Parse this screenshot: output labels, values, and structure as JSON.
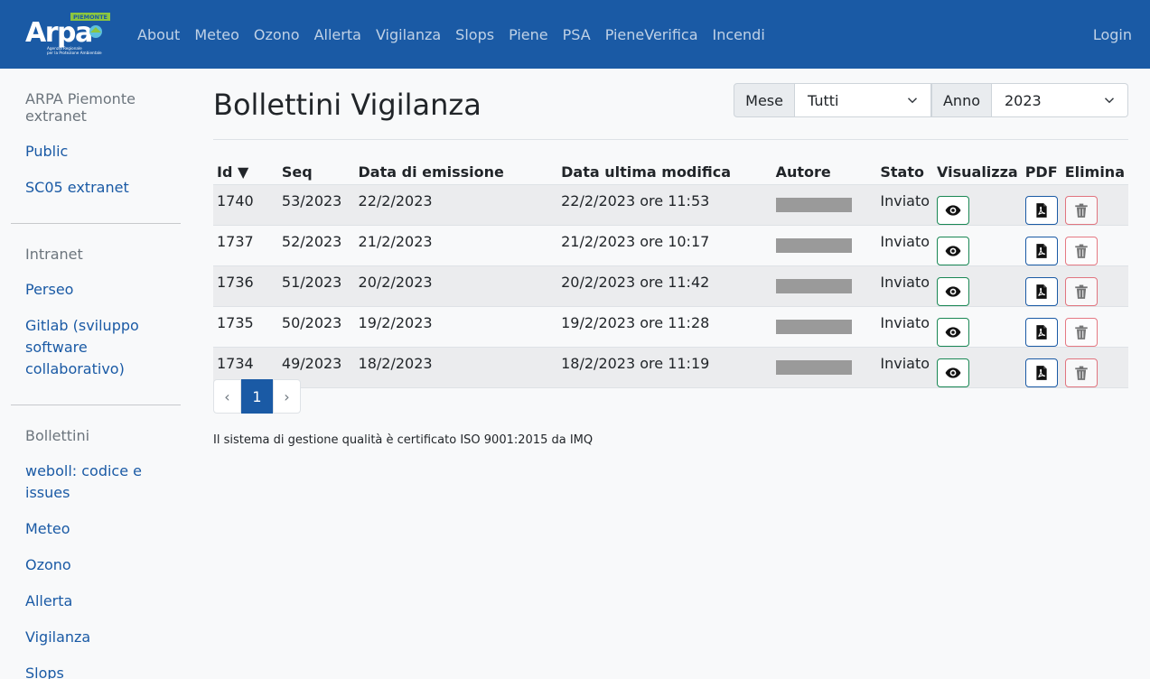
{
  "navbar": {
    "logo_text": "Arpa",
    "logo_region": "PIEMONTE",
    "logo_sub": "Agenzia Regionale per la Protezione Ambientale",
    "links": [
      "About",
      "Meteo",
      "Ozono",
      "Allerta",
      "Vigilanza",
      "Slops",
      "Piene",
      "PSA",
      "PieneVerifica",
      "Incendi"
    ],
    "login": "Login"
  },
  "sidebar": {
    "sections": [
      {
        "heading": "ARPA Piemonte extranet",
        "links": [
          "Public",
          "SC05 extranet"
        ]
      },
      {
        "heading": "Intranet",
        "links": [
          "Perseo",
          "Gitlab (sviluppo software collaborativo)"
        ]
      },
      {
        "heading": "Bollettini",
        "links": [
          "weboll: codice e issues",
          "Meteo",
          "Ozono",
          "Allerta",
          "Vigilanza",
          "Slops"
        ]
      }
    ]
  },
  "main": {
    "title": "Bollettini Vigilanza",
    "filters": {
      "month_label": "Mese",
      "month_value": "Tutti",
      "year_label": "Anno",
      "year_value": "2023"
    },
    "table": {
      "columns": [
        "Id ▼",
        "Seq",
        "Data di emissione",
        "Data ultima modifica",
        "Autore",
        "Stato",
        "Visualizza",
        "PDF",
        "Elimina"
      ],
      "rows": [
        {
          "id": "1740",
          "seq": "53/2023",
          "emission": "22/2/2023",
          "modified": "22/2/2023 ore 11:53",
          "status": "Inviato"
        },
        {
          "id": "1737",
          "seq": "52/2023",
          "emission": "21/2/2023",
          "modified": "21/2/2023 ore 10:17",
          "status": "Inviato"
        },
        {
          "id": "1736",
          "seq": "51/2023",
          "emission": "20/2/2023",
          "modified": "20/2/2023 ore 11:42",
          "status": "Inviato"
        },
        {
          "id": "1735",
          "seq": "50/2023",
          "emission": "19/2/2023",
          "modified": "19/2/2023 ore 11:28",
          "status": "Inviato"
        },
        {
          "id": "1734",
          "seq": "49/2023",
          "emission": "18/2/2023",
          "modified": "18/2/2023 ore 11:19",
          "status": "Inviato"
        }
      ]
    },
    "pagination": {
      "prev": "‹",
      "current": "1",
      "next": "›"
    },
    "footer": "Il sistema di gestione qualità è certificato ISO 9001:2015 da IMQ"
  },
  "colors": {
    "brand": "#1a5aa5",
    "success": "#198754",
    "danger": "#dc3545"
  },
  "icons": {
    "view": "eye-icon",
    "pdf": "file-pdf-icon",
    "delete": "trash-icon",
    "select": "chevron-down-icon"
  }
}
